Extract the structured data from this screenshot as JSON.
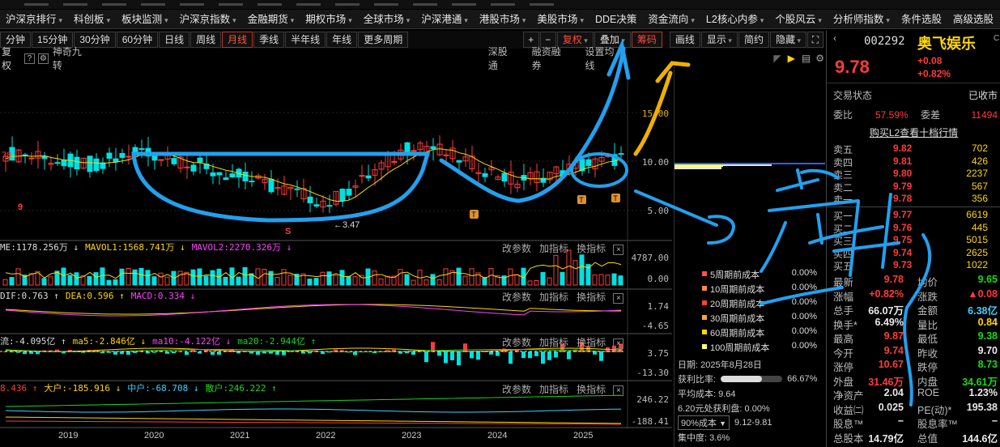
{
  "colors": {
    "up": "#ff3b3b",
    "down": "#00e0e0",
    "accent_red": "#ff3b3b",
    "yellow": "#ffd700",
    "magenta": "#ff40ff",
    "drawing": "#2aa8f0",
    "drawing2": "#f0b000"
  },
  "menu": [
    {
      "label": "沪深京排行"
    },
    {
      "label": "科创板"
    },
    {
      "label": "板块监测"
    },
    {
      "label": "沪深京指数"
    },
    {
      "label": "金融期货"
    },
    {
      "label": "期权市场"
    },
    {
      "label": "全球市场"
    },
    {
      "label": "沪深港通"
    },
    {
      "label": "港股市场"
    },
    {
      "label": "美股市场"
    },
    {
      "label": "DDE决策"
    },
    {
      "label": "资金流向"
    },
    {
      "label": "L2核心内参"
    },
    {
      "label": "个股风云"
    },
    {
      "label": "分析师指数"
    },
    {
      "label": "条件选股"
    },
    {
      "label": "高级选股"
    }
  ],
  "periods": [
    "分钟",
    "15分钟",
    "30分钟",
    "60分钟",
    "日线",
    "周线",
    "月线",
    "季线",
    "半年线",
    "年线",
    "更多周期"
  ],
  "active_period": "月线",
  "tools": {
    "plus": "+",
    "minus": "−",
    "fuquan": "复权",
    "overlay": "叠加",
    "chips": "筹码",
    "draw": "画线",
    "display": "显示",
    "simple": "简约",
    "hide": "隐藏"
  },
  "subbar": {
    "fuquan": "复权",
    "indicator": "神奇九转",
    "shentong": "深股通",
    "rongzi": "融资融券",
    "settings": "设置均线"
  },
  "kline": {
    "labels": {
      "top": "15.00",
      "mid": "10.00",
      "low": "5.00",
      "nine": "9",
      "seven8": "78",
      "lowmark": "←3.47",
      "s": "S"
    }
  },
  "vol": {
    "title_parts": [
      {
        "t": "ME:1178.256万 ↓",
        "c": "#ddd"
      },
      {
        "t": "MAVOL1:1568.741万 ↓",
        "c": "#ffd700"
      },
      {
        "t": "MAVOL2:2270.326万 ↓",
        "c": "#ff40ff"
      }
    ],
    "ax": [
      "4787.00",
      "0.00"
    ]
  },
  "macd": {
    "title_parts": [
      {
        "t": "DIF:0.763 ↑",
        "c": "#ddd"
      },
      {
        "t": "DEA:0.596 ↑",
        "c": "#ffd700"
      },
      {
        "t": "MACD:0.334 ↓",
        "c": "#ff40ff"
      }
    ],
    "ax": [
      "1.74",
      "-4.65"
    ]
  },
  "flow": {
    "title_parts": [
      {
        "t": "流:-4.095亿 ↑",
        "c": "#ddd"
      },
      {
        "t": "ma5:-2.846亿 ↓",
        "c": "#ffd700"
      },
      {
        "t": "ma10:-4.122亿 ↓",
        "c": "#ff40ff"
      },
      {
        "t": "ma20:-2.944亿 ↑",
        "c": "#19d919"
      }
    ],
    "ax": [
      "3.75",
      "-13.30"
    ]
  },
  "big": {
    "title_parts": [
      {
        "t": "8.436 ↑",
        "c": "#ff3b3b"
      },
      {
        "t": "大户:-185.916 ↓",
        "c": "#ffd700"
      },
      {
        "t": "中户:-68.708 ↓",
        "c": "#3fd0ff"
      },
      {
        "t": "散户:246.222 ↑",
        "c": "#19d919"
      }
    ],
    "ax": [
      "246.22",
      "-188.41"
    ]
  },
  "panel_actions": {
    "a": "改参数",
    "b": "加指标",
    "c": "换指标",
    "close": "×"
  },
  "xaxis": [
    "2019",
    "2020",
    "2021",
    "2022",
    "2023",
    "2024",
    "2025"
  ],
  "chips": {
    "cost_rows": [
      {
        "label": "5周期前成本",
        "val": "0.00%",
        "color": "#ff5050"
      },
      {
        "label": "10周期前成本",
        "val": "0.00%",
        "color": "#ff8a40"
      },
      {
        "label": "20周期前成本",
        "val": "0.00%",
        "color": "#ff4040"
      },
      {
        "label": "30周期前成本",
        "val": "0.00%",
        "color": "#ffa040"
      },
      {
        "label": "60周期前成本",
        "val": "0.00%",
        "color": "#ffd700"
      },
      {
        "label": "100周期前成本",
        "val": "0.00%",
        "color": "#ffff80"
      }
    ],
    "date": "日期: 2025年8月28日",
    "profit_label": "获利比率:",
    "profit_pct": "66.67%",
    "profit_fill": 0.6667,
    "avg": "平均成本: 9.64",
    "profit_at": "6.20元处获利盘: 0.00%",
    "cost90": "90%成本",
    "range90": "9.12-9.81",
    "concentration": "集中度: 3.6%"
  },
  "quote": {
    "code": "002292",
    "name": "奥飞娱乐",
    "price": "9.78",
    "change": "+0.08",
    "pct": "+0.82%",
    "status_label": "交易状态",
    "status": "已收市",
    "weibi_label": "委比",
    "weibi": "57.59%",
    "weicha_label": "委差",
    "weicha": "11494",
    "l2": "购买L2查看十档行情",
    "asks": [
      {
        "l": "卖五",
        "p": "9.82",
        "v": "702"
      },
      {
        "l": "卖四",
        "p": "9.81",
        "v": "426"
      },
      {
        "l": "卖三",
        "p": "9.80",
        "v": "2237"
      },
      {
        "l": "卖二",
        "p": "9.79",
        "v": "567"
      },
      {
        "l": "卖一",
        "p": "9.78",
        "v": "356"
      }
    ],
    "bids": [
      {
        "l": "买一",
        "p": "9.77",
        "v": "6619"
      },
      {
        "l": "买二",
        "p": "9.76",
        "v": "445"
      },
      {
        "l": "买三",
        "p": "9.75",
        "v": "5015"
      },
      {
        "l": "买四",
        "p": "9.74",
        "v": "2625"
      },
      {
        "l": "买五",
        "p": "9.73",
        "v": "1022"
      }
    ],
    "stats": [
      {
        "l1": "最新",
        "v1": "9.78",
        "c1": "#ff3b3b",
        "l2": "均价",
        "v2": "9.65",
        "c2": "#19d919"
      },
      {
        "l1": "涨幅",
        "v1": "+0.82%",
        "c1": "#ff3b3b",
        "l2": "涨跌",
        "v2": "▲0.08",
        "c2": "#ff3b3b"
      },
      {
        "l1": "总手",
        "v1": "66.07万",
        "c1": "#e8e8e8",
        "l2": "金额",
        "v2": "6.38亿",
        "c2": "#3fd0ff"
      },
      {
        "l1": "换手*",
        "v1": "6.49%",
        "c1": "#e8e8e8",
        "l2": "量比",
        "v2": "0.84",
        "c2": "#ffd700"
      },
      {
        "l1": "最高",
        "v1": "9.87",
        "c1": "#ff3b3b",
        "l2": "最低",
        "v2": "9.38",
        "c2": "#19d919"
      },
      {
        "l1": "今开",
        "v1": "9.74",
        "c1": "#ff3b3b",
        "l2": "昨收",
        "v2": "9.70",
        "c2": "#e8e8e8"
      },
      {
        "l1": "涨停",
        "v1": "10.67",
        "c1": "#ff3b3b",
        "l2": "跌停",
        "v2": "8.73",
        "c2": "#19d919"
      },
      {
        "l1": "外盘",
        "v1": "31.46万",
        "c1": "#ff3b3b",
        "l2": "内盘",
        "v2": "34.61万",
        "c2": "#19d919"
      },
      {
        "l1": "净资产",
        "v1": "2.04",
        "c1": "#e8e8e8",
        "l2": "ROE",
        "v2": "1.23%",
        "c2": "#e8e8e8"
      },
      {
        "l1": "收益㈡",
        "v1": "0.025",
        "c1": "#e8e8e8",
        "l2": "PE(动)*",
        "v2": "195.38",
        "c2": "#e8e8e8"
      },
      {
        "l1": "股息™",
        "v1": "−",
        "c1": "#e8e8e8",
        "l2": "股息率™",
        "v2": "−",
        "c2": "#e8e8e8"
      },
      {
        "l1": "总股本",
        "v1": "14.79亿",
        "c1": "#e8e8e8",
        "l2": "总值",
        "v2": "144.6亿",
        "c2": "#e8e8e8"
      }
    ]
  }
}
